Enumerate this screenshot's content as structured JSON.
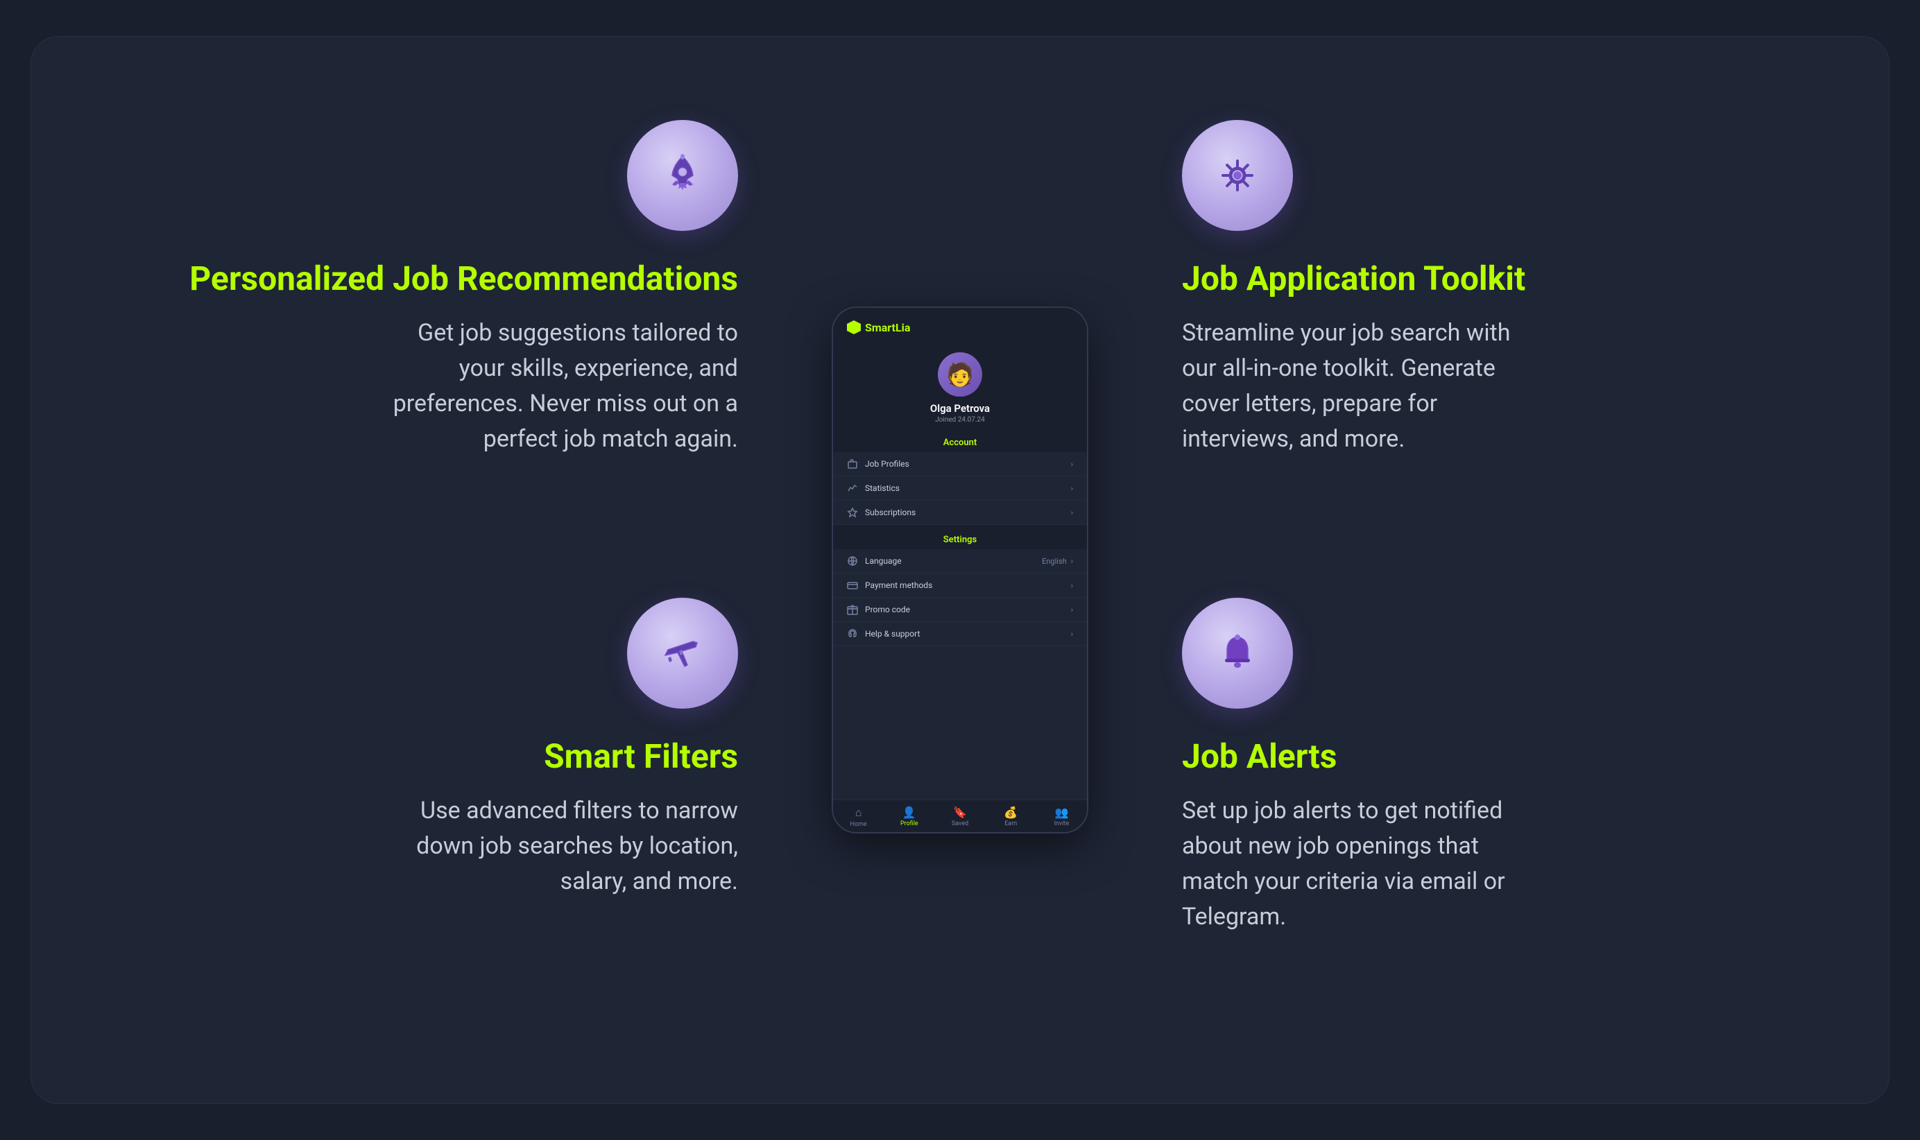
{
  "app": {
    "name": "SmartLia"
  },
  "phone": {
    "user": {
      "name": "Olga Petrova",
      "joined": "Joined 24.07.24"
    },
    "account_section_title": "Account",
    "account_items": [
      {
        "label": "Job Profiles",
        "icon": "briefcase"
      },
      {
        "label": "Statistics",
        "icon": "chart"
      },
      {
        "label": "Subscriptions",
        "icon": "star"
      }
    ],
    "settings_section_title": "Settings",
    "settings_items": [
      {
        "label": "Language",
        "value": "English",
        "icon": "globe"
      },
      {
        "label": "Payment methods",
        "value": "",
        "icon": "card"
      },
      {
        "label": "Promo code",
        "value": "",
        "icon": "gift"
      },
      {
        "label": "Help & support",
        "value": "",
        "icon": "headset"
      }
    ],
    "bottom_nav": [
      {
        "label": "Home",
        "icon": "🏠",
        "active": false
      },
      {
        "label": "Profile",
        "icon": "👤",
        "active": true
      },
      {
        "label": "Saved",
        "icon": "🔖",
        "active": false
      },
      {
        "label": "Earn",
        "icon": "💰",
        "active": false
      },
      {
        "label": "Invite",
        "icon": "👥",
        "active": false
      }
    ]
  },
  "features": {
    "top_left": {
      "title": "Personalized Job Recommendations",
      "description": "Get job suggestions tailored to your skills, experience, and preferences. Never miss out on a perfect job match again.",
      "icon": "rocket"
    },
    "bottom_left": {
      "title": "Smart Filters",
      "description": "Use advanced filters to narrow down job searches by location, salary, and more.",
      "icon": "plane"
    },
    "top_right": {
      "title": "Job Application Toolkit",
      "description": "Streamline your job search with our all-in-one toolkit. Generate cover letters, prepare for interviews, and more.",
      "icon": "gear"
    },
    "bottom_right": {
      "title": "Job Alerts",
      "description": "Set up job alerts to get notified about new job openings that match your criteria via email or Telegram.",
      "icon": "bell"
    }
  }
}
